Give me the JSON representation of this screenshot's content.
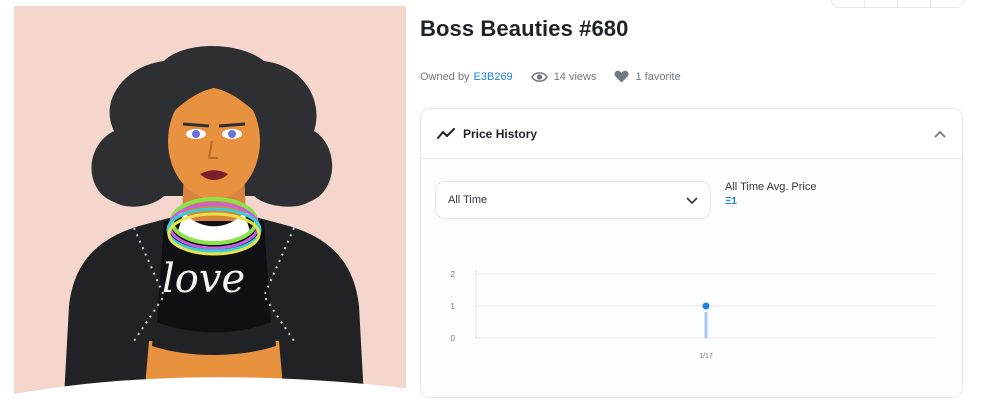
{
  "item": {
    "title": "Boss Beauties #680",
    "owned_by_label": "Owned by",
    "owner": "E3B269",
    "views": "14 views",
    "favorites": "1 favorite"
  },
  "artwork": {
    "shirt_text": "love"
  },
  "price_history": {
    "title": "Price History",
    "period_selected": "All Time",
    "avg_label": "All Time Avg. Price",
    "avg_value": "Ξ1"
  },
  "chart_data": {
    "type": "scatter",
    "categories": [
      "1/17"
    ],
    "series": [
      {
        "x": [
          "1/17"
        ],
        "values": [
          1
        ]
      }
    ],
    "yticks": [
      "0",
      "1",
      "2"
    ],
    "ylim": [
      0,
      2
    ],
    "xlabel": "",
    "ylabel": "",
    "grid": true,
    "colors": {
      "point": "#2081e2",
      "bar": "#a8c8f0",
      "grid": "#e5e8eb"
    }
  },
  "icons": {
    "views": "eye-icon",
    "favorites": "heart-icon",
    "price_history": "trend-icon",
    "collapse": "chevron-up-icon",
    "dropdown": "chevron-down-icon"
  }
}
